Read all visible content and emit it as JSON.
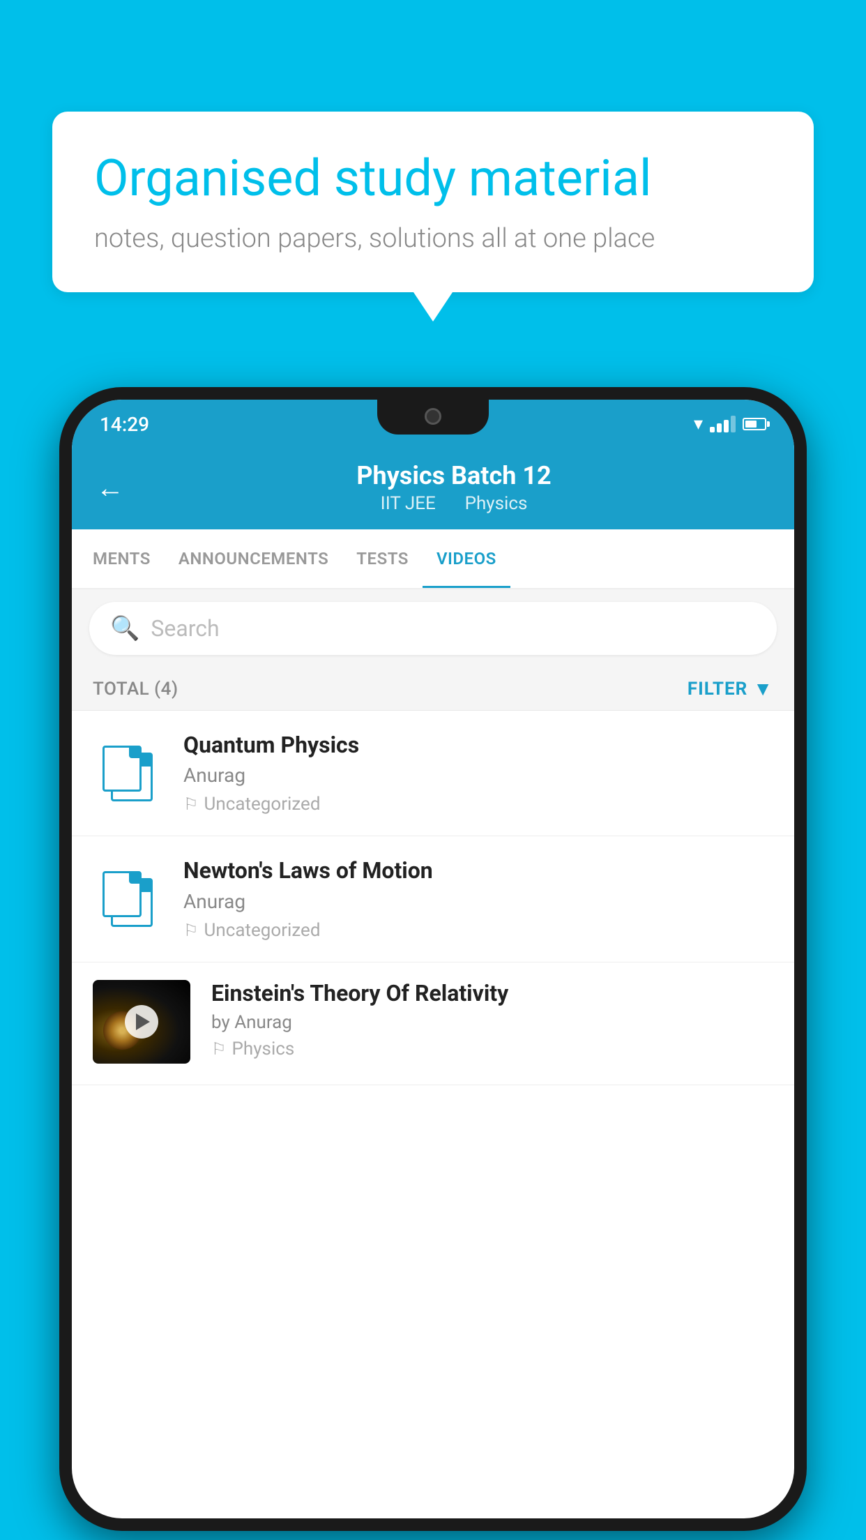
{
  "background_color": "#00BFEA",
  "speech_bubble": {
    "title": "Organised study material",
    "subtitle": "notes, question papers, solutions all at one place"
  },
  "status_bar": {
    "time": "14:29"
  },
  "app_bar": {
    "title": "Physics Batch 12",
    "subtitle_left": "IIT JEE",
    "subtitle_right": "Physics",
    "back_label": "back"
  },
  "tabs": [
    {
      "label": "MENTS",
      "active": false
    },
    {
      "label": "ANNOUNCEMENTS",
      "active": false
    },
    {
      "label": "TESTS",
      "active": false
    },
    {
      "label": "VIDEOS",
      "active": true
    }
  ],
  "search": {
    "placeholder": "Search"
  },
  "filter_bar": {
    "total_label": "TOTAL (4)",
    "filter_label": "FILTER"
  },
  "videos": [
    {
      "id": 1,
      "title": "Quantum Physics",
      "author": "Anurag",
      "tag": "Uncategorized",
      "type": "file",
      "has_thumb": false
    },
    {
      "id": 2,
      "title": "Newton's Laws of Motion",
      "author": "Anurag",
      "tag": "Uncategorized",
      "type": "file",
      "has_thumb": false
    },
    {
      "id": 3,
      "title": "Einstein's Theory Of Relativity",
      "author": "by Anurag",
      "tag": "Physics",
      "type": "video",
      "has_thumb": true
    }
  ]
}
